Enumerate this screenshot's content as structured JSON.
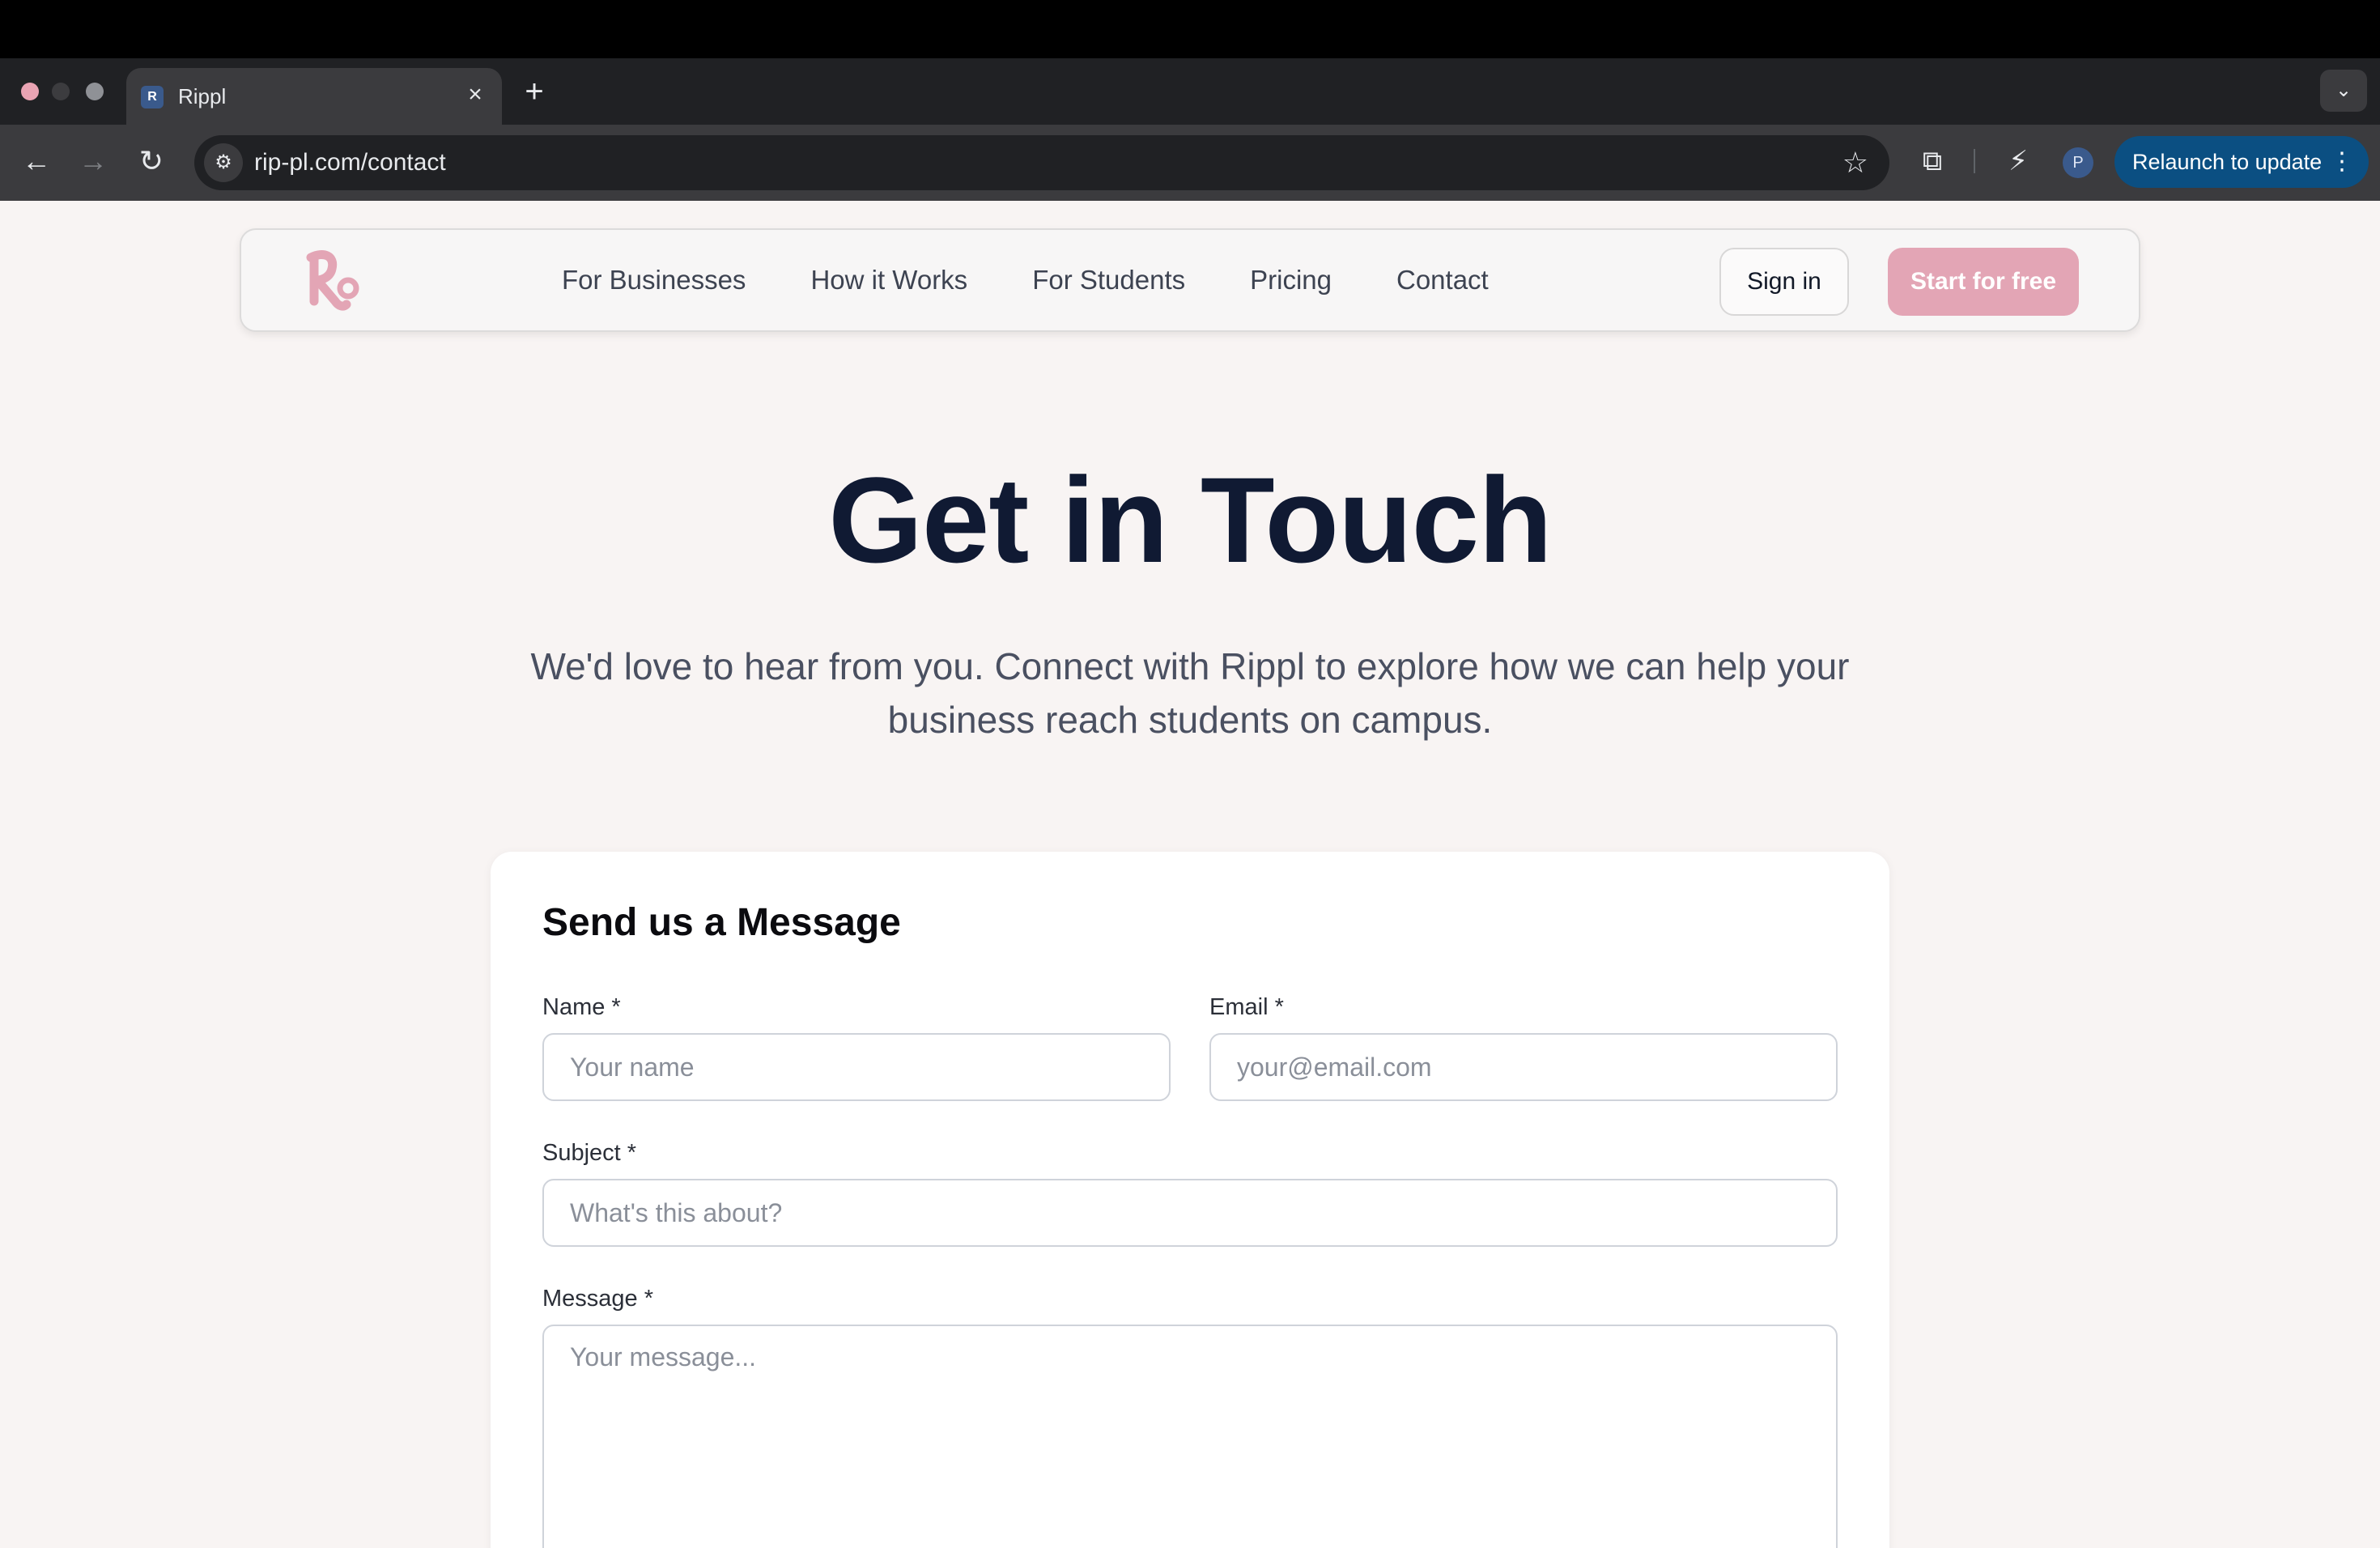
{
  "browser": {
    "tab_title": "Rippl",
    "tab_close": "×",
    "new_tab": "+",
    "tab_menu": "⌄",
    "url": "rip-pl.com/contact",
    "profile_initial": "P",
    "relaunch_label": "Relaunch to update",
    "relaunch_menu": "⋮",
    "icons": {
      "back": "←",
      "forward": "→",
      "reload": "↻",
      "site_info": "⚙",
      "star": "☆",
      "puzzle": "⧉",
      "bolt": "⚡"
    }
  },
  "nav": {
    "links": [
      "For Businesses",
      "How it Works",
      "For Students",
      "Pricing",
      "Contact"
    ],
    "sign_in": "Sign in",
    "start": "Start for free"
  },
  "hero": {
    "title": "Get in Touch",
    "subtitle": "We'd love to hear from you. Connect with Rippl to explore how we can help your business reach students on campus."
  },
  "form": {
    "title": "Send us a Message",
    "name_label": "Name *",
    "name_placeholder": "Your name",
    "email_label": "Email *",
    "email_placeholder": "your@email.com",
    "subject_label": "Subject *",
    "subject_placeholder": "What's this about?",
    "message_label": "Message *",
    "message_placeholder": "Your message..."
  },
  "colors": {
    "brand_pink": "#e3a5b5",
    "heading_navy": "#101a33",
    "relaunch_blue": "#0b4f82"
  }
}
